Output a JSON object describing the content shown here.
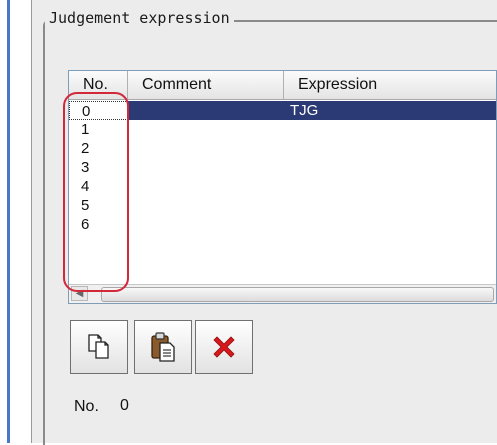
{
  "group": {
    "title": "Judgement expression"
  },
  "table": {
    "columns": [
      "No.",
      "Comment",
      "Expression"
    ],
    "rows": [
      {
        "no": "0",
        "comment": "",
        "expression": "TJG",
        "selected": true
      },
      {
        "no": "1",
        "comment": "",
        "expression": ""
      },
      {
        "no": "2",
        "comment": "",
        "expression": ""
      },
      {
        "no": "3",
        "comment": "",
        "expression": ""
      },
      {
        "no": "4",
        "comment": "",
        "expression": ""
      },
      {
        "no": "5",
        "comment": "",
        "expression": ""
      },
      {
        "no": "6",
        "comment": "",
        "expression": ""
      }
    ]
  },
  "toolbar": {
    "copy_icon": "copy-icon",
    "paste_icon": "paste-icon",
    "delete_icon": "delete-icon"
  },
  "footer": {
    "no_label": "No.",
    "no_value": "0"
  },
  "colors": {
    "selection": "#2b3a74",
    "highlight": "#d2283a",
    "delete": "#d7181c",
    "accent_line": "#4a77c9"
  }
}
